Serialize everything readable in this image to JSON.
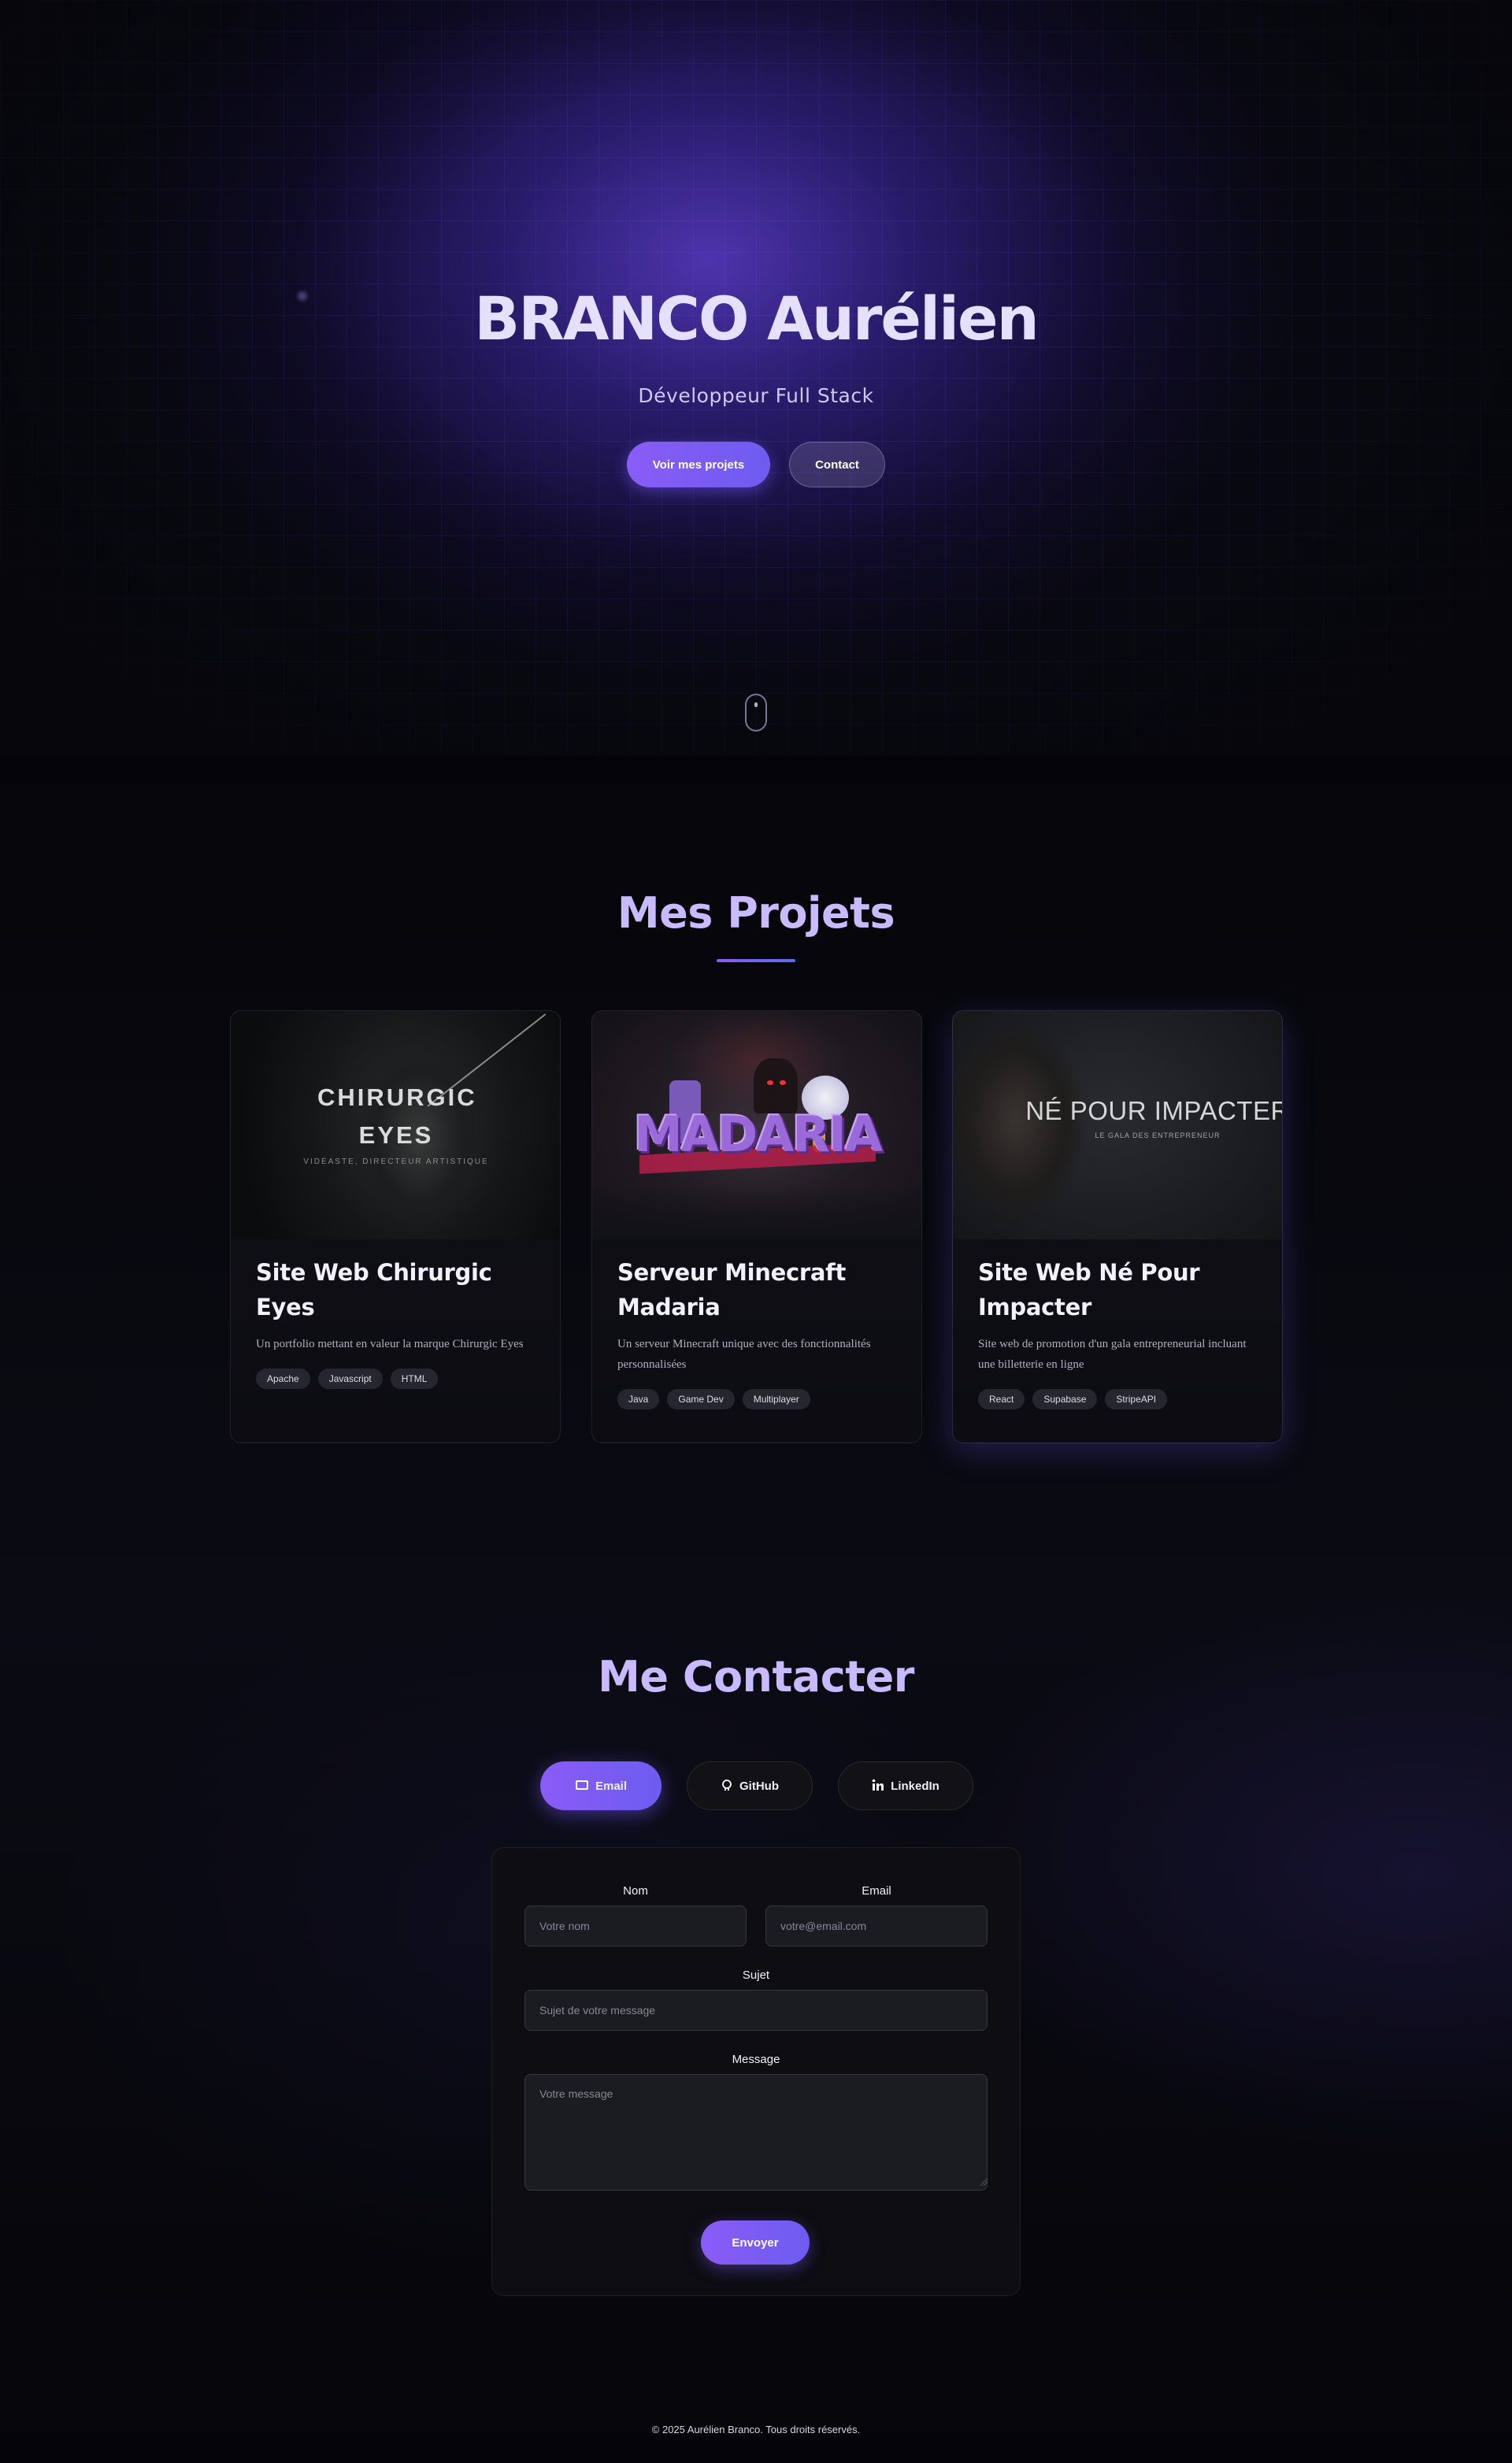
{
  "hero": {
    "title": "BRANCO Aurélien",
    "subtitle": "Développeur Full Stack",
    "primary_button": "Voir mes projets",
    "secondary_button": "Contact"
  },
  "projects": {
    "title": "Mes Projets",
    "items": [
      {
        "image_title": "CHIRURGIC EYES",
        "image_subtitle": "VIDÉASTE, DIRECTEUR ARTISTIQUE",
        "title": "Site Web Chirurgic Eyes",
        "description": "Un portfolio mettant en valeur la marque Chirurgic Eyes",
        "tags": [
          "Apache",
          "Javascript",
          "HTML"
        ]
      },
      {
        "image_title": "MADARIA",
        "title": "Serveur Minecraft Madaria",
        "description": "Un serveur Minecraft unique avec des fonctionnalités personnalisées",
        "tags": [
          "Java",
          "Game Dev",
          "Multiplayer"
        ]
      },
      {
        "image_title": "NÉ POUR IMPACTER",
        "image_subtitle": "LE GALA DES ENTREPRENEUR",
        "title": "Site Web Né Pour Impacter",
        "description": "Site web de promotion d'un gala entrepreneurial incluant une billetterie en ligne",
        "tags": [
          "React",
          "Supabase",
          "StripeAPI"
        ]
      }
    ]
  },
  "contact": {
    "title": "Me Contacter",
    "tabs": [
      {
        "label": "Email",
        "icon": "email-icon",
        "active": true
      },
      {
        "label": "GitHub",
        "icon": "github-icon",
        "active": false
      },
      {
        "label": "LinkedIn",
        "icon": "linkedin-icon",
        "active": false
      }
    ],
    "form": {
      "name_label": "Nom",
      "name_placeholder": "Votre nom",
      "email_label": "Email",
      "email_placeholder": "votre@email.com",
      "subject_label": "Sujet",
      "subject_placeholder": "Sujet de votre message",
      "message_label": "Message",
      "message_placeholder": "Votre message",
      "submit_label": "Envoyer"
    }
  },
  "footer": {
    "copyright": "© 2025 Aurélien Branco. Tous droits réservés."
  },
  "colors": {
    "accent": "#8a5cf6",
    "accent_secondary": "#6d5cf0",
    "title": "#c9baff",
    "background": "#07070c"
  }
}
